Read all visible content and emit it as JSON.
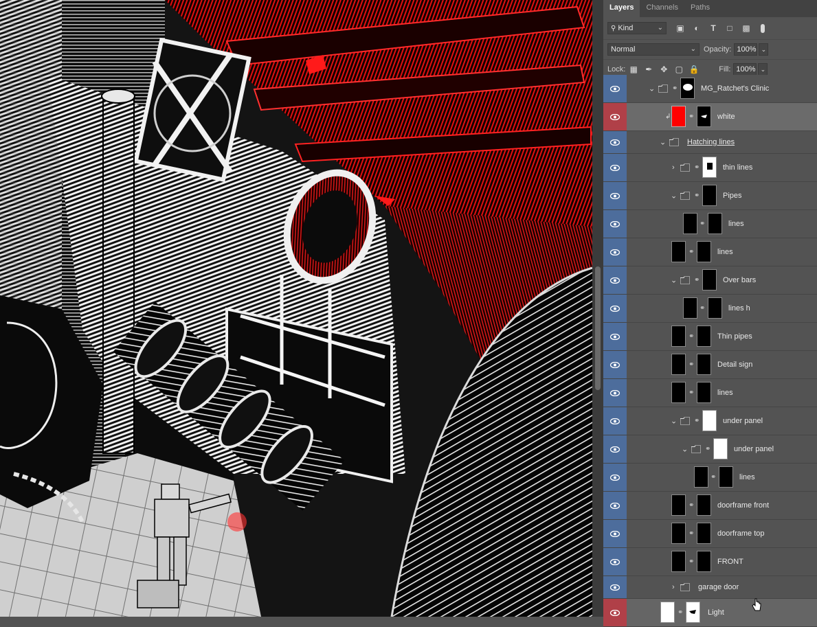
{
  "panel": {
    "tabs": [
      {
        "label": "Layers",
        "active": true
      },
      {
        "label": "Channels",
        "active": false
      },
      {
        "label": "Paths",
        "active": false
      }
    ],
    "filter_kind": "Kind",
    "filter_icons": [
      "image-filter-icon",
      "adjustment-filter-icon",
      "type-filter-icon",
      "shape-filter-icon",
      "smart-object-filter-icon",
      "filter-toggle-icon"
    ],
    "blend_mode": "Normal",
    "opacity_label": "Opacity:",
    "opacity_value": "100%",
    "lock_label": "Lock:",
    "lock_icons": [
      "lock-transparent-icon",
      "lock-image-icon",
      "lock-position-icon",
      "lock-artboard-icon",
      "lock-all-icon"
    ],
    "fill_label": "Fill:",
    "fill_value": "100%"
  },
  "layers": [
    {
      "name": "MG_Ratchet's Clinic",
      "type": "group",
      "expanded": true,
      "visible": true
    },
    {
      "name": "white",
      "type": "layer",
      "visible": true,
      "selected": true,
      "thumb_color": "#ff0000",
      "clipped": true
    },
    {
      "name": "Hatching lines",
      "type": "group",
      "expanded": true,
      "visible": true
    },
    {
      "name": "thin lines",
      "type": "group",
      "expanded": false,
      "visible": true
    },
    {
      "name": "Pipes",
      "type": "group",
      "expanded": true,
      "visible": true
    },
    {
      "name": "lines",
      "type": "layer",
      "visible": true
    },
    {
      "name": "lines",
      "type": "layer",
      "visible": true
    },
    {
      "name": "Over bars",
      "type": "group",
      "expanded": true,
      "visible": true
    },
    {
      "name": "lines h",
      "type": "layer",
      "visible": true
    },
    {
      "name": "Thin pipes",
      "type": "layer",
      "visible": true
    },
    {
      "name": "Detail sign",
      "type": "layer",
      "visible": true
    },
    {
      "name": "lines",
      "type": "layer",
      "visible": true
    },
    {
      "name": "under panel",
      "type": "group",
      "expanded": true,
      "visible": true
    },
    {
      "name": "under panel",
      "type": "group",
      "expanded": true,
      "visible": true
    },
    {
      "name": "lines",
      "type": "layer",
      "visible": true
    },
    {
      "name": "doorframe front",
      "type": "layer",
      "visible": true
    },
    {
      "name": "doorframe top",
      "type": "layer",
      "visible": true
    },
    {
      "name": "FRONT",
      "type": "layer",
      "visible": true
    },
    {
      "name": "garage door",
      "type": "group",
      "expanded": false,
      "visible": true
    },
    {
      "name": "Light",
      "type": "layer",
      "visible": true,
      "highlighted": true
    }
  ],
  "colors": {
    "accent_red": "#ff1a1a",
    "eye_column": "#4d6d9c",
    "selected_eye": "#b04048",
    "panel_bg": "#535353"
  }
}
